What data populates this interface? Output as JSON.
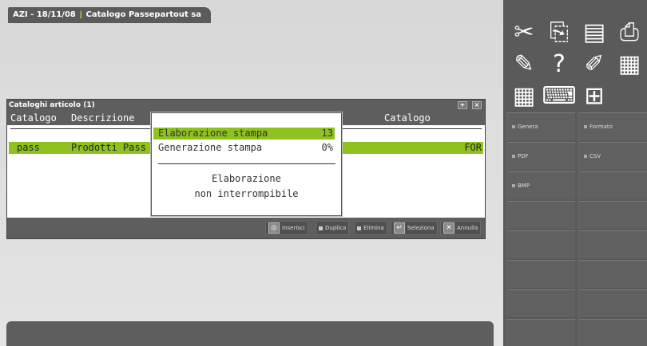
{
  "title": {
    "company": "AZI - 18/11/08",
    "separator": "|",
    "app": "Catalogo Passepartout sa"
  },
  "panel": {
    "title": "Cataloghi articolo (1)",
    "columns": {
      "catalogo": "Catalogo",
      "descrizione": "Descrizione",
      "catalogo_right": "Catalogo"
    },
    "row": {
      "code": "pass",
      "desc": "Prodotti Pass",
      "right": "FOR"
    },
    "footer": {
      "inserisci": "Inserisci",
      "duplica": "Duplica",
      "elimina": "Elimina",
      "seleziona": "Seleziona",
      "annulla": "Annulla"
    }
  },
  "dialog": {
    "line1_label": "Elaborazione stampa",
    "line1_value": "13",
    "line2_label": "Generazione stampa",
    "line2_value": "0%",
    "message_line1": "Elaborazione",
    "message_line2": "non interrompibile"
  },
  "sidebar": {
    "icons": [
      "scissors-icon",
      "copy-icon",
      "paste-icon",
      "printer-icon",
      "wrench-icon",
      "help-icon",
      "notes-icon",
      "box-icon",
      "calculator-icon",
      "keyboard-icon",
      "grid-icon"
    ],
    "buttons": {
      "genera": "Genera",
      "formato": "Formato",
      "pdf": "PDF",
      "csv": "CSV",
      "bmp": "BMP"
    }
  },
  "colors": {
    "accent": "#8fc21e",
    "dark": "#5e5e5e"
  }
}
